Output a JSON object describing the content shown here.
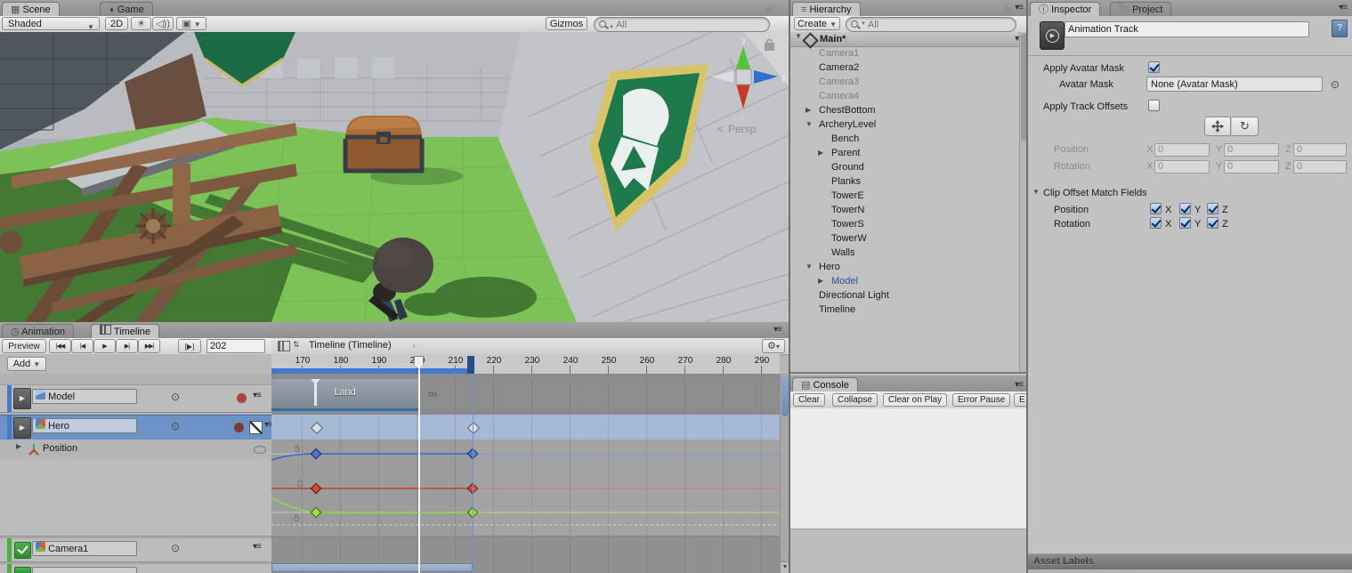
{
  "colors": {
    "accent_blue": "#3f7fd8",
    "selection_blue": "#6d92c6",
    "record_red": "#b04338",
    "prefab_text_blue": "#27519c",
    "clip_edge_blue": "#2f6fa8",
    "grass_green": "#7dc257",
    "banner_green": "#1e7a4b",
    "banner_gold": "#d8c468"
  },
  "scene_view": {
    "tabs": [
      {
        "label": "Scene"
      },
      {
        "label": "Game"
      }
    ],
    "toolbar": {
      "draw_mode": "Shaded",
      "mode_2d": "2D",
      "gizmos_label": "Gizmos",
      "search_placeholder": "All"
    },
    "gizmo": {
      "x": "x",
      "y": "y",
      "z": "z",
      "persp": "Persp"
    }
  },
  "hierarchy": {
    "tab_label": "Hierarchy",
    "create_label": "Create",
    "search_placeholder": "All",
    "scene_name": "Main*",
    "items": [
      {
        "label": "Camera1"
      },
      {
        "label": "Camera2"
      },
      {
        "label": "Camera3"
      },
      {
        "label": "Camera4"
      },
      {
        "label": "ChestBottom"
      },
      {
        "label": "ArcheryLevel"
      },
      {
        "label": "Bench"
      },
      {
        "label": "Parent"
      },
      {
        "label": "Ground"
      },
      {
        "label": "Planks"
      },
      {
        "label": "TowerE"
      },
      {
        "label": "TowerN"
      },
      {
        "label": "TowerS"
      },
      {
        "label": "TowerW"
      },
      {
        "label": "Walls"
      },
      {
        "label": "Hero"
      },
      {
        "label": "Model"
      },
      {
        "label": "Directional Light"
      },
      {
        "label": "Timeline"
      }
    ]
  },
  "inspector": {
    "tabs": [
      {
        "label": "Inspector"
      },
      {
        "label": "Project"
      }
    ],
    "track_name": "Animation Track",
    "apply_avatar_mask_label": "Apply Avatar Mask",
    "avatar_mask_label": "Avatar Mask",
    "avatar_mask_value": "None (Avatar Mask)",
    "apply_track_offsets_label": "Apply Track Offsets",
    "position_label": "Position",
    "rotation_label": "Rotation",
    "x": "X",
    "y": "Y",
    "z": "Z",
    "position": {
      "x": "0",
      "y": "0",
      "z": "0"
    },
    "rotation": {
      "x": "0",
      "y": "0",
      "z": "0"
    },
    "clip_offset_header": "Clip Offset Match Fields",
    "match_position_label": "Position",
    "match_rotation_label": "Rotation",
    "asset_labels": "Asset Labels"
  },
  "timeline": {
    "tabs": [
      {
        "label": "Animation"
      },
      {
        "label": "Timeline"
      }
    ],
    "preview_label": "Preview",
    "transport": {
      "first": "|◀◀",
      "prev": "|◀",
      "play": "▶",
      "next": "▶|",
      "last": "▶▶|",
      "range_play": "[▶]"
    },
    "frame": "202",
    "add_label": "Add",
    "breadcrumb": "Timeline (Timeline)",
    "ruler_ticks": [
      "170",
      "180",
      "190",
      "200",
      "210",
      "220",
      "230",
      "240",
      "250",
      "260",
      "270",
      "280",
      "290"
    ],
    "tracks": [
      {
        "name": "Model"
      },
      {
        "name": "Hero"
      },
      {
        "name": "Position"
      },
      {
        "name": "Camera1"
      }
    ],
    "clip_label": "Land",
    "infinity": "∞",
    "curve_labels": {
      "five": "5",
      "zero": "0",
      "minus_five": "-5"
    }
  },
  "console": {
    "tab_label": "Console",
    "buttons": [
      {
        "label": "Clear"
      },
      {
        "label": "Collapse"
      },
      {
        "label": "Clear on Play"
      },
      {
        "label": "Error Pause"
      },
      {
        "label": "E"
      }
    ]
  }
}
